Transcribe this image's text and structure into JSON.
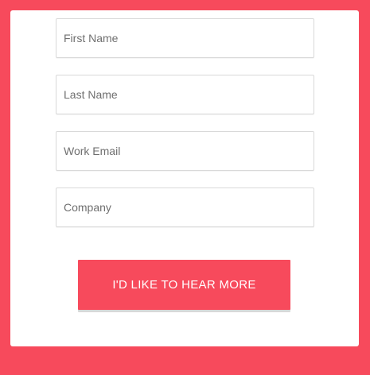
{
  "colors": {
    "background": "#f74a5c",
    "card": "#ffffff",
    "button": "#f74a5c",
    "button_text": "#ffffff",
    "field_border": "#d9d9d9",
    "placeholder": "#6f6f6f"
  },
  "form": {
    "fields": [
      {
        "placeholder": "First Name",
        "value": ""
      },
      {
        "placeholder": "Last Name",
        "value": ""
      },
      {
        "placeholder": "Work Email",
        "value": ""
      },
      {
        "placeholder": "Company",
        "value": ""
      }
    ],
    "submit_label": "I'D LIKE TO HEAR MORE"
  }
}
